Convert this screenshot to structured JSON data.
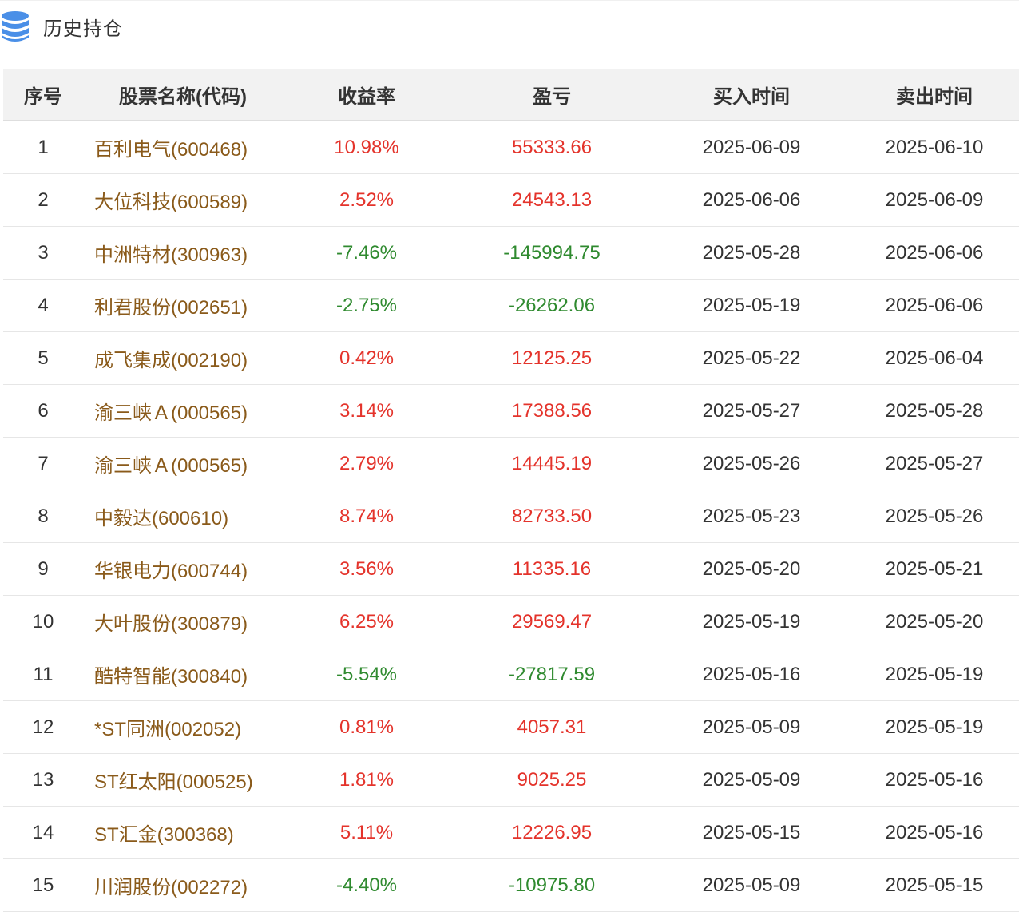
{
  "section": {
    "title": "历史持仓",
    "icon": "database-icon"
  },
  "colors": {
    "up": "#e4332b",
    "down": "#2f8a2f",
    "name": "#8a5a1a",
    "accent": "#3b82e0"
  },
  "columns": [
    "序号",
    "股票名称(代码)",
    "收益率",
    "盈亏",
    "买入时间",
    "卖出时间"
  ],
  "rows": [
    {
      "no": "1",
      "name": "百利电气(600468)",
      "rate": "10.98%",
      "pnl": "55333.66",
      "buy": "2025-06-09",
      "sell": "2025-06-10"
    },
    {
      "no": "2",
      "name": "大位科技(600589)",
      "rate": "2.52%",
      "pnl": "24543.13",
      "buy": "2025-06-06",
      "sell": "2025-06-09"
    },
    {
      "no": "3",
      "name": "中洲特材(300963)",
      "rate": "-7.46%",
      "pnl": "-145994.75",
      "buy": "2025-05-28",
      "sell": "2025-06-06"
    },
    {
      "no": "4",
      "name": "利君股份(002651)",
      "rate": "-2.75%",
      "pnl": "-26262.06",
      "buy": "2025-05-19",
      "sell": "2025-06-06"
    },
    {
      "no": "5",
      "name": "成飞集成(002190)",
      "rate": "0.42%",
      "pnl": "12125.25",
      "buy": "2025-05-22",
      "sell": "2025-06-04"
    },
    {
      "no": "6",
      "name": "渝三峡Ａ(000565)",
      "rate": "3.14%",
      "pnl": "17388.56",
      "buy": "2025-05-27",
      "sell": "2025-05-28"
    },
    {
      "no": "7",
      "name": "渝三峡Ａ(000565)",
      "rate": "2.79%",
      "pnl": "14445.19",
      "buy": "2025-05-26",
      "sell": "2025-05-27"
    },
    {
      "no": "8",
      "name": "中毅达(600610)",
      "rate": "8.74%",
      "pnl": "82733.50",
      "buy": "2025-05-23",
      "sell": "2025-05-26"
    },
    {
      "no": "9",
      "name": "华银电力(600744)",
      "rate": "3.56%",
      "pnl": "11335.16",
      "buy": "2025-05-20",
      "sell": "2025-05-21"
    },
    {
      "no": "10",
      "name": "大叶股份(300879)",
      "rate": "6.25%",
      "pnl": "29569.47",
      "buy": "2025-05-19",
      "sell": "2025-05-20"
    },
    {
      "no": "11",
      "name": "酷特智能(300840)",
      "rate": "-5.54%",
      "pnl": "-27817.59",
      "buy": "2025-05-16",
      "sell": "2025-05-19"
    },
    {
      "no": "12",
      "name": "*ST同洲(002052)",
      "rate": "0.81%",
      "pnl": "4057.31",
      "buy": "2025-05-09",
      "sell": "2025-05-19"
    },
    {
      "no": "13",
      "name": "ST红太阳(000525)",
      "rate": "1.81%",
      "pnl": "9025.25",
      "buy": "2025-05-09",
      "sell": "2025-05-16"
    },
    {
      "no": "14",
      "name": "ST汇金(300368)",
      "rate": "5.11%",
      "pnl": "12226.95",
      "buy": "2025-05-15",
      "sell": "2025-05-16"
    },
    {
      "no": "15",
      "name": "川润股份(002272)",
      "rate": "-4.40%",
      "pnl": "-10975.80",
      "buy": "2025-05-09",
      "sell": "2025-05-15"
    }
  ]
}
